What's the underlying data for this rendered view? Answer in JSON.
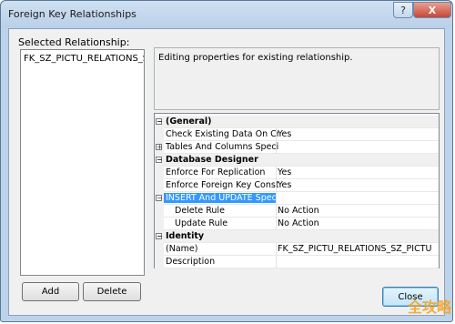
{
  "window": {
    "title": "Foreign Key Relationships"
  },
  "titlebar": {
    "help_label": "?",
    "close_label": "X"
  },
  "selected_label": "Selected Relationship:",
  "relationships": [
    "FK_SZ_PICTU_RELATIONS_SZ_P"
  ],
  "description": "Editing properties for existing relationship.",
  "properties": [
    {
      "type": "category",
      "expander": "⊟",
      "name": "(General)",
      "value": ""
    },
    {
      "type": "prop",
      "name": "Check Existing Data On Cre",
      "value": "Yes"
    },
    {
      "type": "prop",
      "expander": "⊞",
      "name": "Tables And Columns Specifi",
      "value": ""
    },
    {
      "type": "category",
      "expander": "⊟",
      "name": "Database Designer",
      "value": ""
    },
    {
      "type": "prop",
      "name": "Enforce For Replication",
      "value": "Yes"
    },
    {
      "type": "prop",
      "name": "Enforce Foreign Key Constra",
      "value": "Yes"
    },
    {
      "type": "selected",
      "expander": "⊟",
      "name": "INSERT And UPDATE Specifi",
      "value": ""
    },
    {
      "type": "sub",
      "name": "Delete Rule",
      "value": "No Action"
    },
    {
      "type": "sub",
      "name": "Update Rule",
      "value": "No Action"
    },
    {
      "type": "category",
      "expander": "⊟",
      "name": "Identity",
      "value": ""
    },
    {
      "type": "prop",
      "name": "(Name)",
      "value": "FK_SZ_PICTU_RELATIONS_SZ_PICTU"
    },
    {
      "type": "prop",
      "name": "Description",
      "value": ""
    }
  ],
  "buttons": {
    "add": "Add",
    "delete": "Delete",
    "close": "Close"
  },
  "watermark": "全攻略"
}
